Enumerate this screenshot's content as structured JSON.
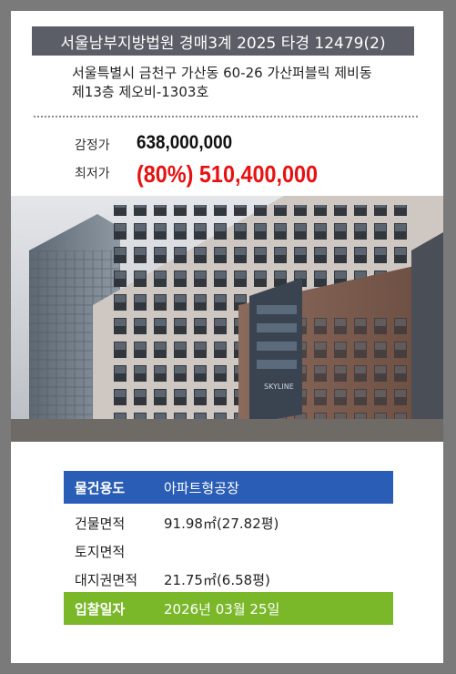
{
  "header": {
    "court_case": "서울남부지방법원 경매3계 2025 타경 12479(2)"
  },
  "address": {
    "line1": "서울특별시 금천구 가산동 60-26 가산퍼블릭 제비동",
    "line2": "제13층 제오비-1303호"
  },
  "price": {
    "appraisal_label": "감정가",
    "appraisal_value": "638,000,000",
    "minimum_label": "최저가",
    "minimum_value": "(80%) 510,400,000"
  },
  "photo": {
    "sign_text": "SKYLINE",
    "icon": "building-photo"
  },
  "details": {
    "usage_label": "물건용도",
    "usage_value": "아파트형공장",
    "building_area_label": "건물면적",
    "building_area_value": "91.98㎡(27.82평)",
    "land_area_label": "토지면적",
    "land_area_value": "",
    "land_right_label": "대지권면적",
    "land_right_value": "21.75㎡(6.58평)",
    "bid_date_label": "입찰일자",
    "bid_date_value": "2026년 03월 25일"
  },
  "colors": {
    "header_bg": "#5b5e66",
    "usage_bg": "#2a5db5",
    "bid_bg": "#7ab82a",
    "min_price": "#e81010"
  }
}
